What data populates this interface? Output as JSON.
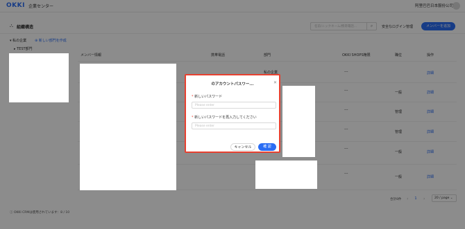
{
  "header": {
    "logo": "OKKI",
    "app_title": "企業センター",
    "company": "阿里巴巴日本服份公司"
  },
  "toolbar": {
    "section_title": "組織構造",
    "search_placeholder": "名前/ニックネーム/携帯電話...",
    "safe_login": "安全なログイン管理",
    "add_member": "メンバーを追加"
  },
  "tree": {
    "root": "私の企業",
    "new_dept": "新しい部門を作成",
    "child": "TEST部門",
    "crm_note": "OKKI CRMは使用されています：8 / 10"
  },
  "table": {
    "headers": [
      "メンバー情報",
      "携帯電話",
      "部門",
      "OKKI SHOPS権限",
      "職位",
      "操作"
    ],
    "rows": [
      {
        "dept": "私の企業",
        "shops": "---",
        "position": "",
        "action": "詳細"
      },
      {
        "dept": "",
        "shops": "---",
        "position": "一般",
        "action": "詳細"
      },
      {
        "dept": "",
        "shops": "---",
        "position": "管理",
        "action": "詳細"
      },
      {
        "dept": "",
        "shops": "---",
        "position": "管理",
        "action": "詳細"
      },
      {
        "dept": "",
        "shops": "---",
        "position": "一般",
        "action": "詳細"
      },
      {
        "dept": "",
        "shops": "---",
        "position": "一般",
        "action": "詳細"
      }
    ]
  },
  "pagination": {
    "total": "合計8件",
    "current": "1",
    "page_size": "20 / page"
  },
  "modal": {
    "title": "のアカウントパスワー...",
    "label_new": "新しいパスワード",
    "placeholder_new": "Please enter",
    "label_confirm": "新しいパスワードを再入力してください",
    "placeholder_confirm": "Please enter",
    "cancel": "キャンセル",
    "ok": "確 認",
    "required_mark": "*"
  },
  "colors": {
    "accent": "#2a6df4",
    "highlight_border": "#e8402f"
  }
}
